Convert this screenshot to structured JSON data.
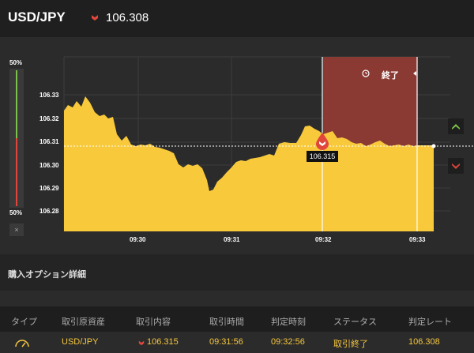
{
  "header": {
    "pair": "USD/JPY",
    "rate": "106.308"
  },
  "meter": {
    "top_pct": "50%",
    "bottom_pct": "50%",
    "collapse_icon": "×"
  },
  "chart": {
    "y_ticks": [
      "106.33",
      "106.32",
      "106.31",
      "106.30",
      "106.29",
      "106.28"
    ],
    "x_ticks": [
      "09:30",
      "09:31",
      "09:32",
      "09:33"
    ],
    "entry_label": "106.315",
    "end_label": "終了",
    "colors": {
      "area": "#f9c93c",
      "ended_zone": "#8b3a33",
      "up": "#7cc14b",
      "down": "#e0473c"
    }
  },
  "section": {
    "title": "購入オプション詳細"
  },
  "table": {
    "headers": [
      "タイプ",
      "取引原資産",
      "取引内容",
      "取引時間",
      "判定時刻",
      "ステータス",
      "判定レート"
    ],
    "row": {
      "asset": "USD/JPY",
      "content": "106.315",
      "time": "09:31:56",
      "judge_time": "09:32:56",
      "status": "取引終了",
      "judge_rate": "106.308"
    }
  }
}
